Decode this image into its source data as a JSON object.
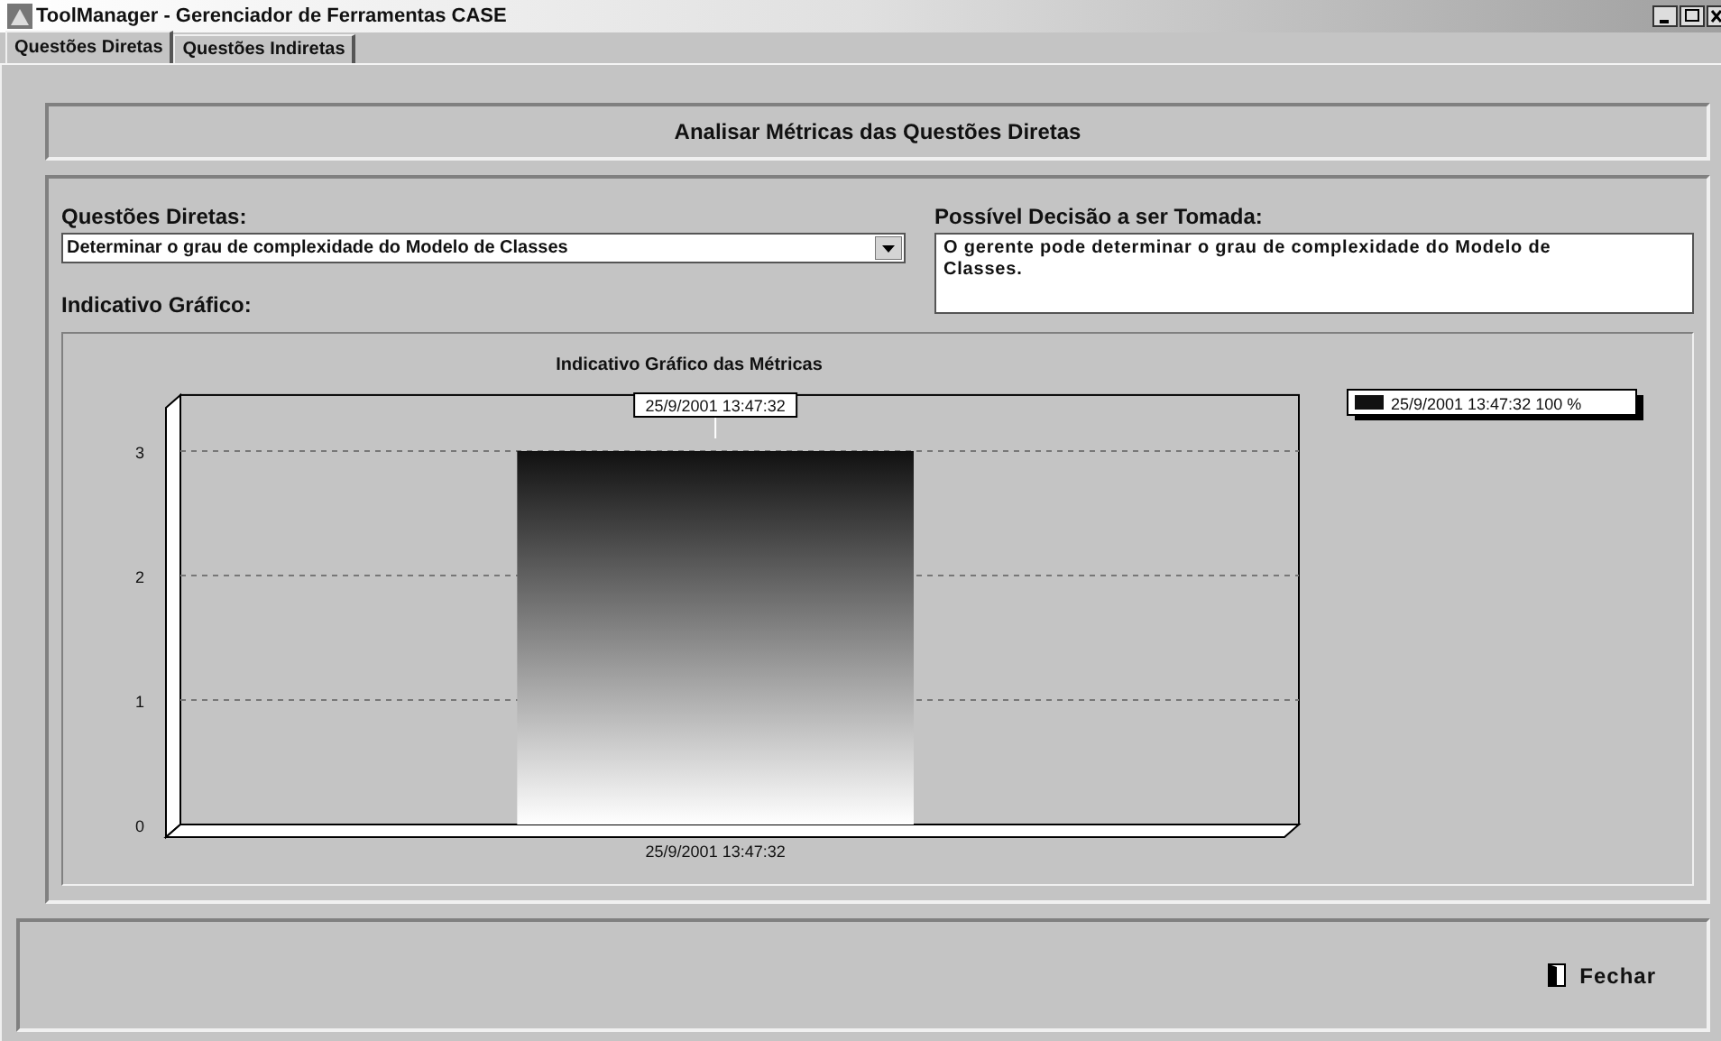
{
  "window": {
    "title": "ToolManager - Gerenciador de Ferramentas CASE"
  },
  "tabs": [
    {
      "label": "Questões Diretas",
      "selected": true
    },
    {
      "label": "Questões Indiretas",
      "selected": false
    }
  ],
  "header": {
    "title": "Analisar Métricas das Questões Diretas"
  },
  "question": {
    "label": "Questões Diretas:",
    "value": "Determinar o grau de complexidade do Modelo de Classes"
  },
  "decision": {
    "label": "Possível Decisão a ser Tomada:",
    "value": "O gerente pode determinar o grau de complexidade do Modelo de Classes."
  },
  "graph": {
    "label": "Indicativo Gráfico:",
    "legend": {
      "label": "25/9/2001 13:47:32 100 %"
    },
    "chart_data": {
      "type": "bar",
      "title": "Indicativo Gráfico das Métricas",
      "categories": [
        "25/9/2001 13:47:32"
      ],
      "series": [
        {
          "name": "25/9/2001 13:47:32",
          "color": "#111111",
          "values": [
            3
          ]
        }
      ],
      "ylim": [
        0,
        3.45
      ],
      "yticks": [
        0,
        1,
        2,
        3
      ],
      "grid": true
    }
  },
  "buttons": [
    {
      "label": "Fechar"
    }
  ]
}
